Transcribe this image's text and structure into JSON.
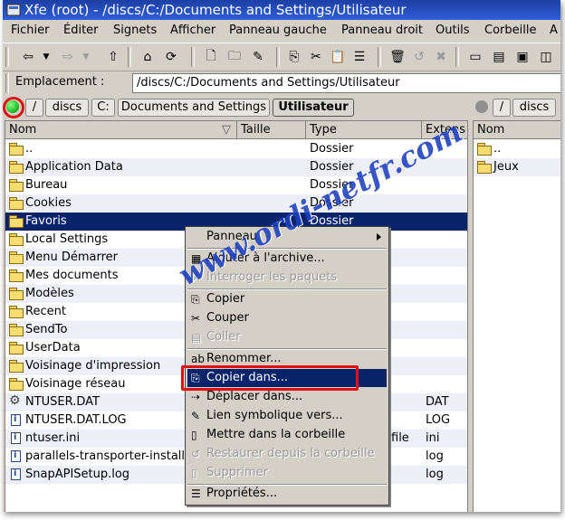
{
  "window": {
    "title": "Xfe (root) - /discs/C:/Documents and Settings/Utilisateur"
  },
  "menubar": [
    "Fichier",
    "Éditer",
    "Signets",
    "Afficher",
    "Panneau gauche",
    "Panneau droit",
    "Outils",
    "Corbeille",
    "A"
  ],
  "location": {
    "label": "Emplacement :",
    "value": "/discs/C:/Documents and Settings/Utilisateur"
  },
  "left_panel": {
    "breadcrumbs": [
      "/",
      "discs",
      "C:",
      "Documents and Settings",
      "Utilisateur"
    ],
    "columns": [
      "Nom",
      "Taille",
      "Type",
      "Extens"
    ],
    "rows": [
      {
        "icon": "folder-up-icon",
        "name": "..",
        "size": "",
        "type": "Dossier",
        "ext": ""
      },
      {
        "icon": "folder-icon",
        "name": "Application Data",
        "size": "",
        "type": "Dossier",
        "ext": ""
      },
      {
        "icon": "folder-icon",
        "name": "Bureau",
        "size": "",
        "type": "Dossier",
        "ext": ""
      },
      {
        "icon": "folder-icon",
        "name": "Cookies",
        "size": "",
        "type": "Dossier",
        "ext": ""
      },
      {
        "icon": "folder-icon",
        "name": "Favoris",
        "size": "",
        "type": "Dossier",
        "ext": ""
      },
      {
        "icon": "folder-icon",
        "name": "Local Settings",
        "size": "",
        "type": "",
        "ext": ""
      },
      {
        "icon": "folder-icon",
        "name": "Menu Démarrer",
        "size": "",
        "type": "",
        "ext": ""
      },
      {
        "icon": "folder-icon",
        "name": "Mes documents",
        "size": "",
        "type": "",
        "ext": ""
      },
      {
        "icon": "folder-icon",
        "name": "Modèles",
        "size": "",
        "type": "",
        "ext": ""
      },
      {
        "icon": "folder-icon",
        "name": "Recent",
        "size": "",
        "type": "",
        "ext": ""
      },
      {
        "icon": "folder-icon",
        "name": "SendTo",
        "size": "",
        "type": "",
        "ext": ""
      },
      {
        "icon": "folder-icon",
        "name": "UserData",
        "size": "",
        "type": "",
        "ext": ""
      },
      {
        "icon": "folder-icon",
        "name": "Voisinage d'impression",
        "size": "",
        "type": "",
        "ext": ""
      },
      {
        "icon": "folder-icon",
        "name": "Voisinage réseau",
        "size": "",
        "type": "",
        "ext": ""
      },
      {
        "icon": "gear-file-icon",
        "name": "NTUSER.DAT",
        "size": "",
        "type": "",
        "ext": "DAT"
      },
      {
        "icon": "info-file-icon",
        "name": "NTUSER.DAT.LOG",
        "size": "",
        "type": "",
        "ext": "LOG"
      },
      {
        "icon": "text-file-icon",
        "name": "ntuser.ini",
        "size": "",
        "type": "file",
        "ext": "ini"
      },
      {
        "icon": "info-file-icon",
        "name": "parallels-transporter-install",
        "size": "",
        "type": "",
        "ext": "log"
      },
      {
        "icon": "info-file-icon",
        "name": "SnapAPISetup.log",
        "size": "",
        "type": "",
        "ext": "log"
      }
    ]
  },
  "right_panel": {
    "breadcrumbs": [
      "/",
      "discs"
    ],
    "columns": [
      "Nom"
    ],
    "rows": [
      {
        "icon": "folder-up-icon",
        "name": ".."
      },
      {
        "icon": "folder-icon",
        "name": "Jeux"
      }
    ]
  },
  "context_menu": {
    "items": [
      "Panneau",
      "Ajouter à l'archive...",
      "Interroger les paquets",
      "Copier",
      "Couper",
      "Coller",
      "Renommer...",
      "Copier dans...",
      "Déplacer dans...",
      "Lien symbolique vers...",
      "Mettre dans la corbeille",
      "Restaurer depuis la corbeille",
      "Supprimer",
      "Propriétés..."
    ]
  },
  "watermark": "www.ordi-netfr.com",
  "colors": {
    "selection": "#0a246a",
    "highlight_box": "#e01010",
    "led_active": "#22c022",
    "led_inactive": "#909090",
    "titlebar": "#1c3fa4"
  }
}
